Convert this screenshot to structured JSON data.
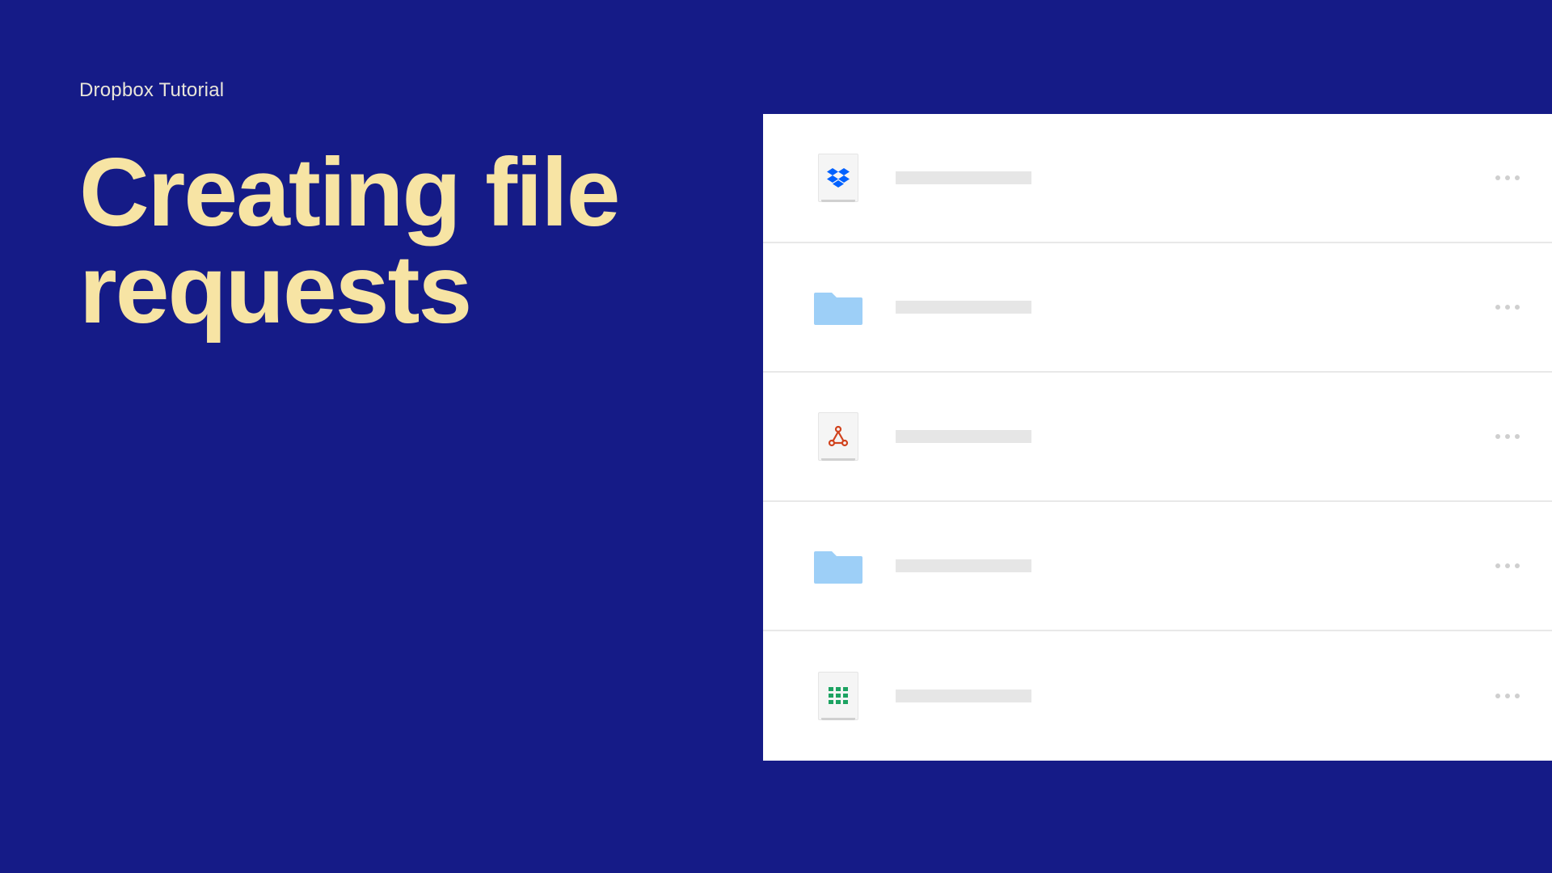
{
  "eyebrow": "Dropbox Tutorial",
  "headline_line1": "Creating file",
  "headline_line2": "requests",
  "rows": [
    {
      "icon": "dropbox",
      "container": "tile"
    },
    {
      "icon": "folder",
      "container": "folder"
    },
    {
      "icon": "pdf",
      "container": "tile"
    },
    {
      "icon": "folder",
      "container": "folder"
    },
    {
      "icon": "sheets",
      "container": "tile"
    }
  ],
  "colors": {
    "background": "#151B87",
    "headline": "#F7E4A4",
    "eyebrow": "#E8E5D9",
    "placeholder": "#E6E6E6",
    "folder": "#9DCFF7",
    "dropbox": "#0061FF",
    "pdf": "#D1431E",
    "sheets": "#1DA362"
  }
}
